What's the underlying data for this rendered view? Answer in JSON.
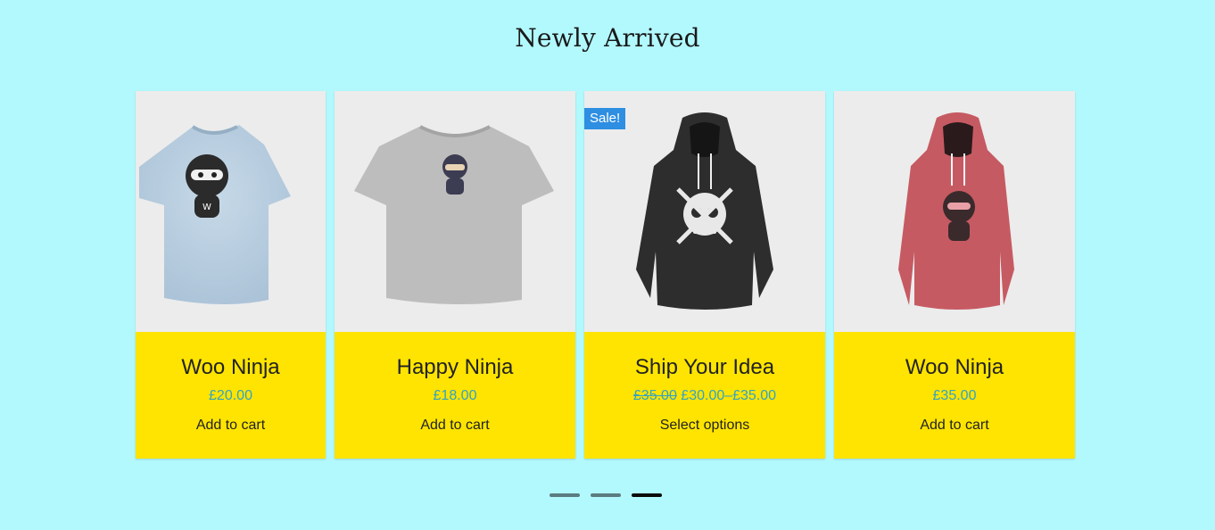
{
  "section": {
    "title": "Newly Arrived"
  },
  "products": [
    {
      "name": "Woo Ninja",
      "price": "£20.00",
      "action": "Add to cart",
      "image": "light-blue-tshirt-ninja-image",
      "color": "#b8cfe0"
    },
    {
      "name": "Happy Ninja",
      "price": "£18.00",
      "action": "Add to cart",
      "image": "grey-tshirt-ninja-image",
      "color": "#b9b9b9"
    },
    {
      "name": "Ship Your Idea",
      "old_price": "£35.00",
      "price_range": "£30.00–£35.00",
      "action": "Select options",
      "badge": "Sale!",
      "image": "black-hoodie-skull-image",
      "color": "#2a2a2a"
    },
    {
      "name": "Woo Ninja",
      "price": "£35.00",
      "action": "Add to cart",
      "image": "red-hoodie-ninja-image",
      "color": "#c65a62"
    }
  ],
  "pagination": {
    "pages": 3,
    "active": 3
  },
  "colors": {
    "background": "#b2f9fe",
    "card_info": "#fee400",
    "price": "#34a3c4",
    "sale_badge": "#2e8ee2"
  }
}
